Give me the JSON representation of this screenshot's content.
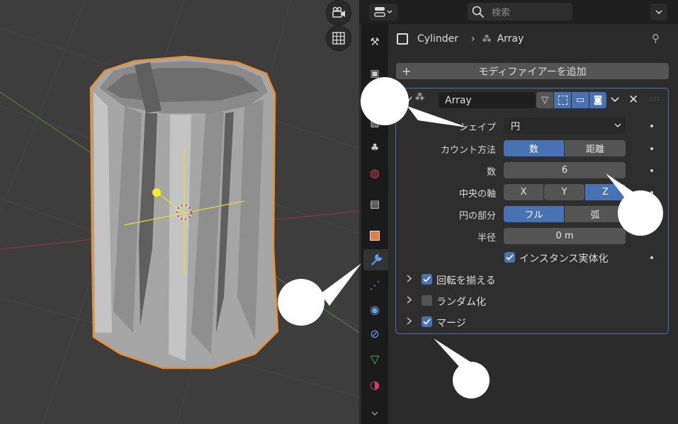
{
  "header": {
    "search_placeholder": "検索"
  },
  "breadcrumb": {
    "object": "Cylinder",
    "modifier": "Array"
  },
  "add_modifier_label": "モディファイアーを追加",
  "modifier": {
    "name": "Array",
    "fit_type_label": "シェイプ",
    "fit_type_value": "円",
    "count_method_label": "カウント方法",
    "count_method_options": [
      "数",
      "距離"
    ],
    "count_label": "数",
    "count_value": "6",
    "center_axis_label": "中央の軸",
    "axis_options": [
      "X",
      "Y",
      "Z"
    ],
    "circle_part_label": "円の部分",
    "circle_part_options": [
      "フル",
      "弧"
    ],
    "radius_label": "半径",
    "radius_value": "0 m",
    "realize_label": "インスタンス実体化",
    "subpanels": [
      {
        "label": "回転を揃える",
        "checked": true
      },
      {
        "label": "ランダム化",
        "checked": false
      },
      {
        "label": "マージ",
        "checked": true
      }
    ]
  },
  "colors": {
    "accent": "#4772b3",
    "selection_outline": "#e8902a",
    "panel_bg": "#2b2b2b",
    "viewport_bg": "#3d3d3d"
  }
}
